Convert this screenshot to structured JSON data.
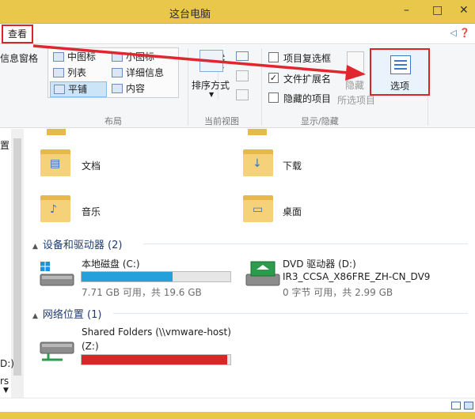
{
  "window": {
    "title": "这台电脑",
    "minimize": "–",
    "maximize": "□",
    "close": "✕"
  },
  "tabs": {
    "active": "查看",
    "help_icon": "help-icon"
  },
  "ribbon": {
    "nav_pane_label": "信息窗格",
    "layout": {
      "items": [
        "中图标",
        "小图标",
        "列表",
        "详细信息",
        "平铺",
        "内容"
      ],
      "selected": "平铺",
      "group_label": "布局"
    },
    "current_view": {
      "sort_label": "排序方式",
      "group_label": "当前视图"
    },
    "show_hide": {
      "item_checkbox_label": "项目复选框",
      "file_ext_label": "文件扩展名",
      "hidden_items_label": "隐藏的项目",
      "hide_label": "隐藏",
      "hide_selected_label": "所选项目",
      "group_label": "显示/隐藏",
      "file_ext_checked": true,
      "item_checkbox_checked": false,
      "hidden_items_checked": false
    },
    "options_label": "选项"
  },
  "nav": {
    "items": [
      "置",
      "D:)",
      "rs",
      "s"
    ]
  },
  "folders": [
    "文档",
    "下载",
    "音乐",
    "桌面"
  ],
  "devices": {
    "header": "设备和驱动器 (2)",
    "local_disk": {
      "name": "本地磁盘 (C:)",
      "space": "7.71 GB 可用，共 19.6 GB",
      "used_fraction": 0.61,
      "color": "#26a0da"
    },
    "dvd": {
      "name": "DVD 驱动器 (D:)",
      "label": "IR3_CCSA_X86FRE_ZH-CN_DV9",
      "space": "0 字节 可用，共 2.99 GB"
    }
  },
  "network": {
    "header": "网络位置 (1)",
    "shared": {
      "name": "Shared Folders (\\\\vmware-host)",
      "drive": "(Z:)",
      "used_fraction": 0.98,
      "color": "#da2626"
    }
  },
  "colors": {
    "accent_red": "#d9242a",
    "titlebar": "#e8c74a"
  }
}
